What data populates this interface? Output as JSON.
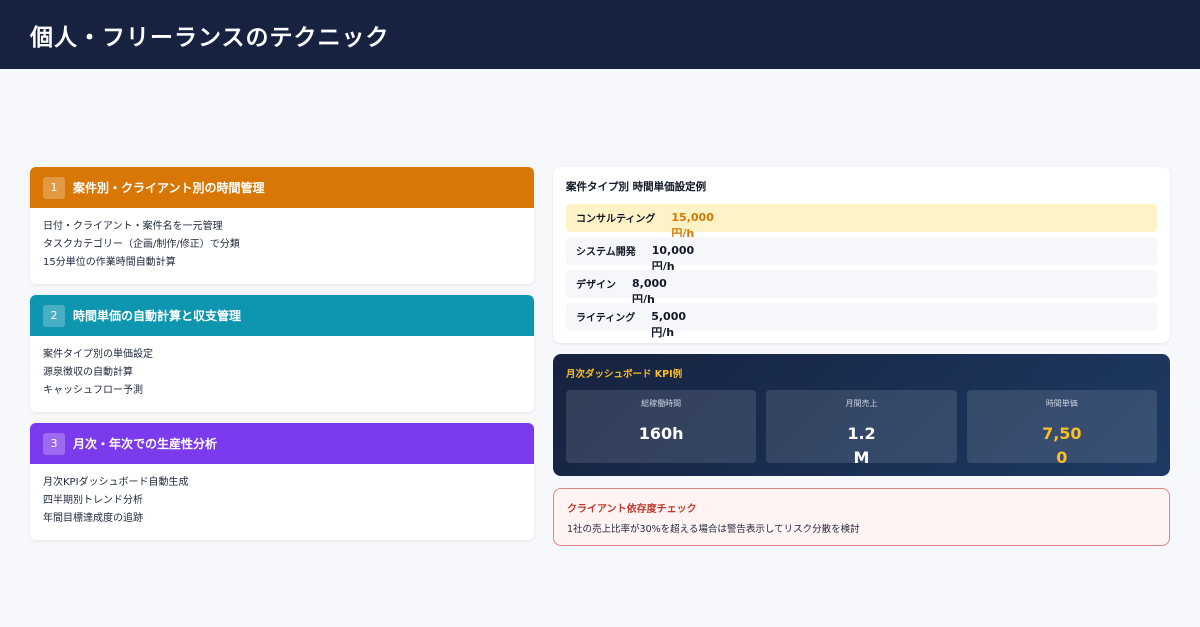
{
  "header": {
    "title": "個人・フリーランスのテクニック"
  },
  "sections": [
    {
      "number": "1",
      "title": "案件別・クライアント別の時間管理",
      "color": "#d97706",
      "items": [
        "日付・クライアント・案件名を一元管理",
        "タスクカテゴリー（企画/制作/修正）で分類",
        "15分単位の作業時間自動計算"
      ]
    },
    {
      "number": "2",
      "title": "時間単価の自動計算と収支管理",
      "color": "#0e95b0",
      "items": [
        "案件タイプ別の単価設定",
        "源泉徴収の自動計算",
        "キャッシュフロー予測"
      ]
    },
    {
      "number": "3",
      "title": "月次・年次での生産性分析",
      "color": "#7c3aed",
      "items": [
        "月次KPIダッシュボード自動生成",
        "四半期別トレンド分析",
        "年間目標達成度の追跡"
      ]
    }
  ],
  "rates": {
    "title": "案件タイプ別 時間単価設定例",
    "rows": [
      {
        "name": "コンサルティング",
        "value": "15,000円/h",
        "highlight": true
      },
      {
        "name": "システム開発",
        "value": "10,000円/h",
        "highlight": false
      },
      {
        "name": "デザイン",
        "value": "8,000円/h",
        "highlight": false
      },
      {
        "name": "ライティング",
        "value": "5,000円/h",
        "highlight": false
      }
    ]
  },
  "kpi": {
    "title": "月次ダッシュボード KPI例",
    "boxes": [
      {
        "label": "総稼働時間",
        "value": "160h"
      },
      {
        "label": "月間売上",
        "value": "1.2M"
      },
      {
        "label": "時間単価",
        "value": "7,500"
      }
    ]
  },
  "alert": {
    "title": "クライアント依存度チェック",
    "text": "1社の売上比率が30%を超える場合は警告表示してリスク分散を検討"
  }
}
